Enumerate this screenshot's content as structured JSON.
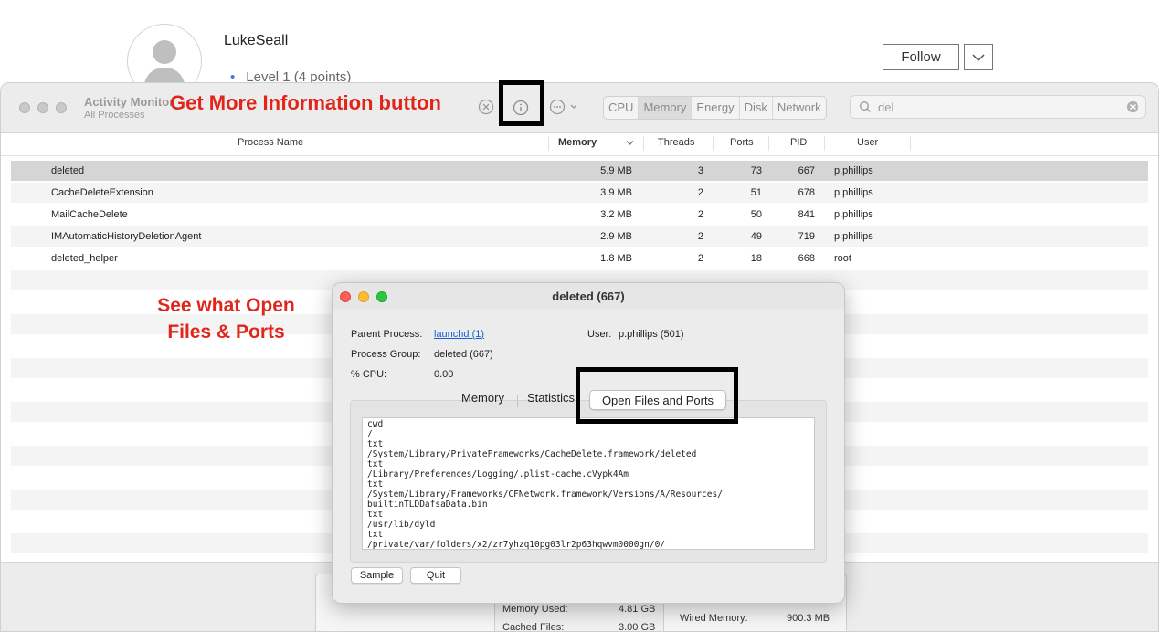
{
  "profile": {
    "username": "LukeSeall",
    "level": "Level 1  (4 points)",
    "follow_label": "Follow"
  },
  "am": {
    "title": "Activity Monitor",
    "subtitle": "All Processes",
    "tabs": [
      "CPU",
      "Memory",
      "Energy",
      "Disk",
      "Network"
    ],
    "active_tab": "Memory",
    "search_value": "del",
    "columns": {
      "process_name": "Process Name",
      "memory": "Memory",
      "threads": "Threads",
      "ports": "Ports",
      "pid": "PID",
      "user": "User"
    },
    "rows": [
      {
        "name": "deleted",
        "memory": "5.9 MB",
        "threads": "3",
        "ports": "73",
        "pid": "667",
        "user": "p.phillips"
      },
      {
        "name": "CacheDeleteExtension",
        "memory": "3.9 MB",
        "threads": "2",
        "ports": "51",
        "pid": "678",
        "user": "p.phillips"
      },
      {
        "name": "MailCacheDelete",
        "memory": "3.2 MB",
        "threads": "2",
        "ports": "50",
        "pid": "841",
        "user": "p.phillips"
      },
      {
        "name": "IMAutomaticHistoryDeletionAgent",
        "memory": "2.9 MB",
        "threads": "2",
        "ports": "49",
        "pid": "719",
        "user": "p.phillips"
      },
      {
        "name": "deleted_helper",
        "memory": "1.8 MB",
        "threads": "2",
        "ports": "18",
        "pid": "668",
        "user": "root"
      }
    ],
    "memory_panel": {
      "memory_used_label": "Memory Used:",
      "memory_used_value": "4.81 GB",
      "cached_files_label": "Cached Files:",
      "cached_files_value": "3.00 GB",
      "wired_memory_label": "Wired Memory:",
      "wired_memory_value": "900.3 MB"
    }
  },
  "annotations": {
    "get_info": "Get More Information button",
    "open_files": "See what Open Files & Ports"
  },
  "dialog": {
    "title": "deleted (667)",
    "parent_process_label": "Parent Process:",
    "parent_process_value": "launchd (1)",
    "user_label": "User:",
    "user_value": "p.phillips (501)",
    "process_group_label": "Process Group:",
    "process_group_value": "deleted (667)",
    "cpu_label": "% CPU:",
    "cpu_value": "0.00",
    "tabs": [
      "Memory",
      "Statistics",
      "Open Files and Ports"
    ],
    "selected_tab": "Open Files and Ports",
    "files": [
      "cwd",
      "/",
      "txt",
      "/System/Library/PrivateFrameworks/CacheDelete.framework/deleted",
      "txt",
      "/Library/Preferences/Logging/.plist-cache.cVypk4Am",
      "txt",
      "/System/Library/Frameworks/CFNetwork.framework/Versions/A/Resources/",
      "builtinTLDDafsaData.bin",
      "txt",
      "/usr/lib/dyld",
      "txt",
      "/private/var/folders/x2/zr7yhzq10pg03lr2p63hqwvm0000gn/0/"
    ],
    "sample_label": "Sample",
    "quit_label": "Quit"
  },
  "colors": {
    "annotation_red": "#e0261b",
    "selection_gray": "#d5d5d5",
    "link_blue": "#1a5fd4"
  }
}
